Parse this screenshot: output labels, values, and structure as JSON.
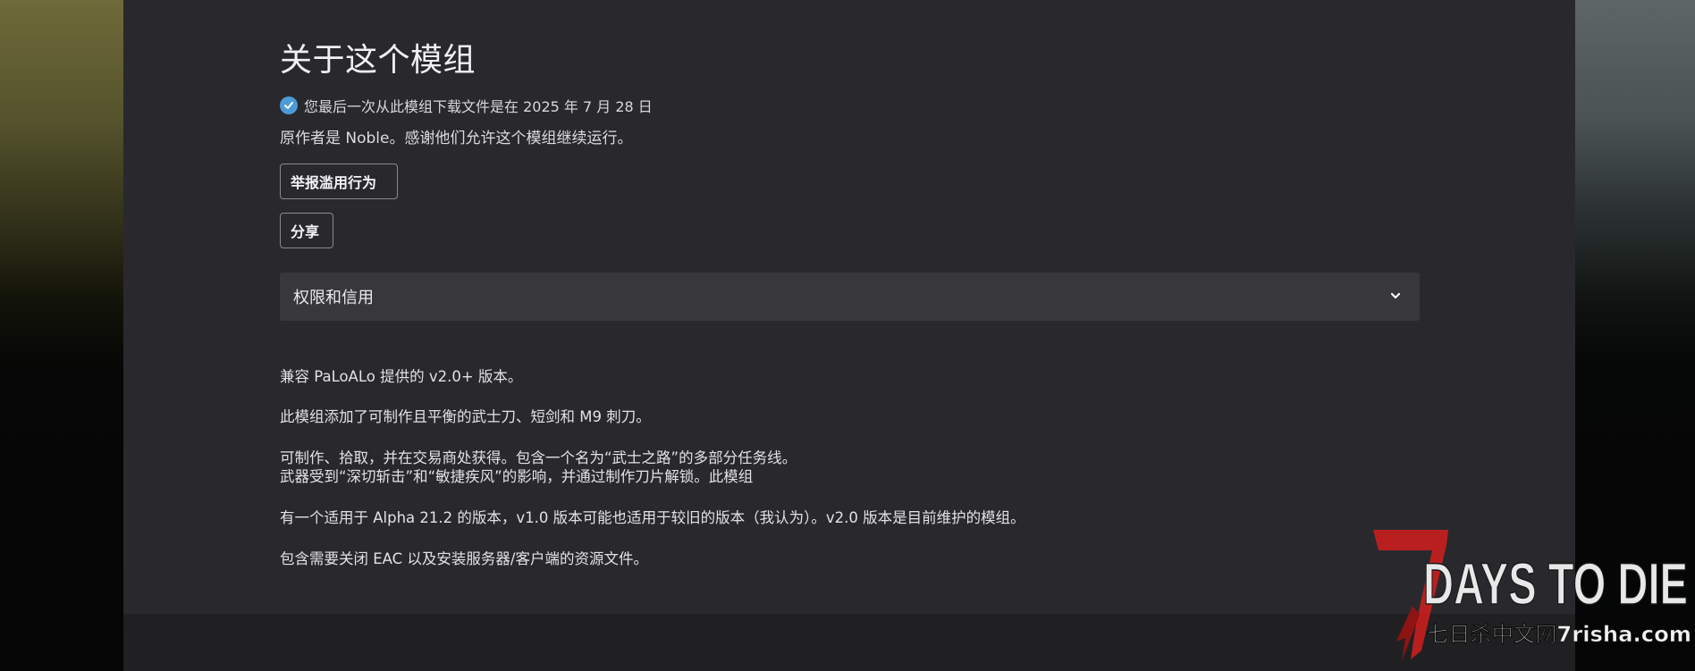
{
  "page": {
    "title": "关于这个模组",
    "download_note": "您最后一次从此模组下载文件是在 2025 年 7 月 28 日",
    "author_note": "原作者是 Noble。感谢他们允许这个模组继续运行。"
  },
  "buttons": {
    "report_label": "举报滥用行为",
    "share_label": "分享"
  },
  "accordion": {
    "label": "权限和信用"
  },
  "description": {
    "line1": "兼容 PaLoALo 提供的 v2.0+ 版本。",
    "line2": "此模组添加了可制作且平衡的武士刀、短剑和 M9 刺刀。",
    "line3": "可制作、拾取，并在交易商处获得。包含一个名为“武士之路”的多部分任务线。",
    "line4": "武器受到“深切斩击”和“敏捷疾风”的影响，并通过制作刀片解锁。此模组",
    "line5": "有一个适用于 Alpha 21.2 的版本，v1.0 版本可能也适用于较旧的版本（我认为）。v2.0 版本是目前维护的模组。",
    "line6": "包含需要关闭 EAC 以及安装服务器/客户端的资源文件。"
  },
  "watermark": {
    "big_text": "DAYS TO DIE",
    "sub_text": "七日杀中文网7risha.com",
    "icons": [
      "checkmark-icon",
      "chevron-down-icon"
    ]
  },
  "colors": {
    "panel": "#29292d",
    "accordion": "#37373c",
    "check": "#4d9bd6",
    "logo_red": "#c21f1f"
  }
}
